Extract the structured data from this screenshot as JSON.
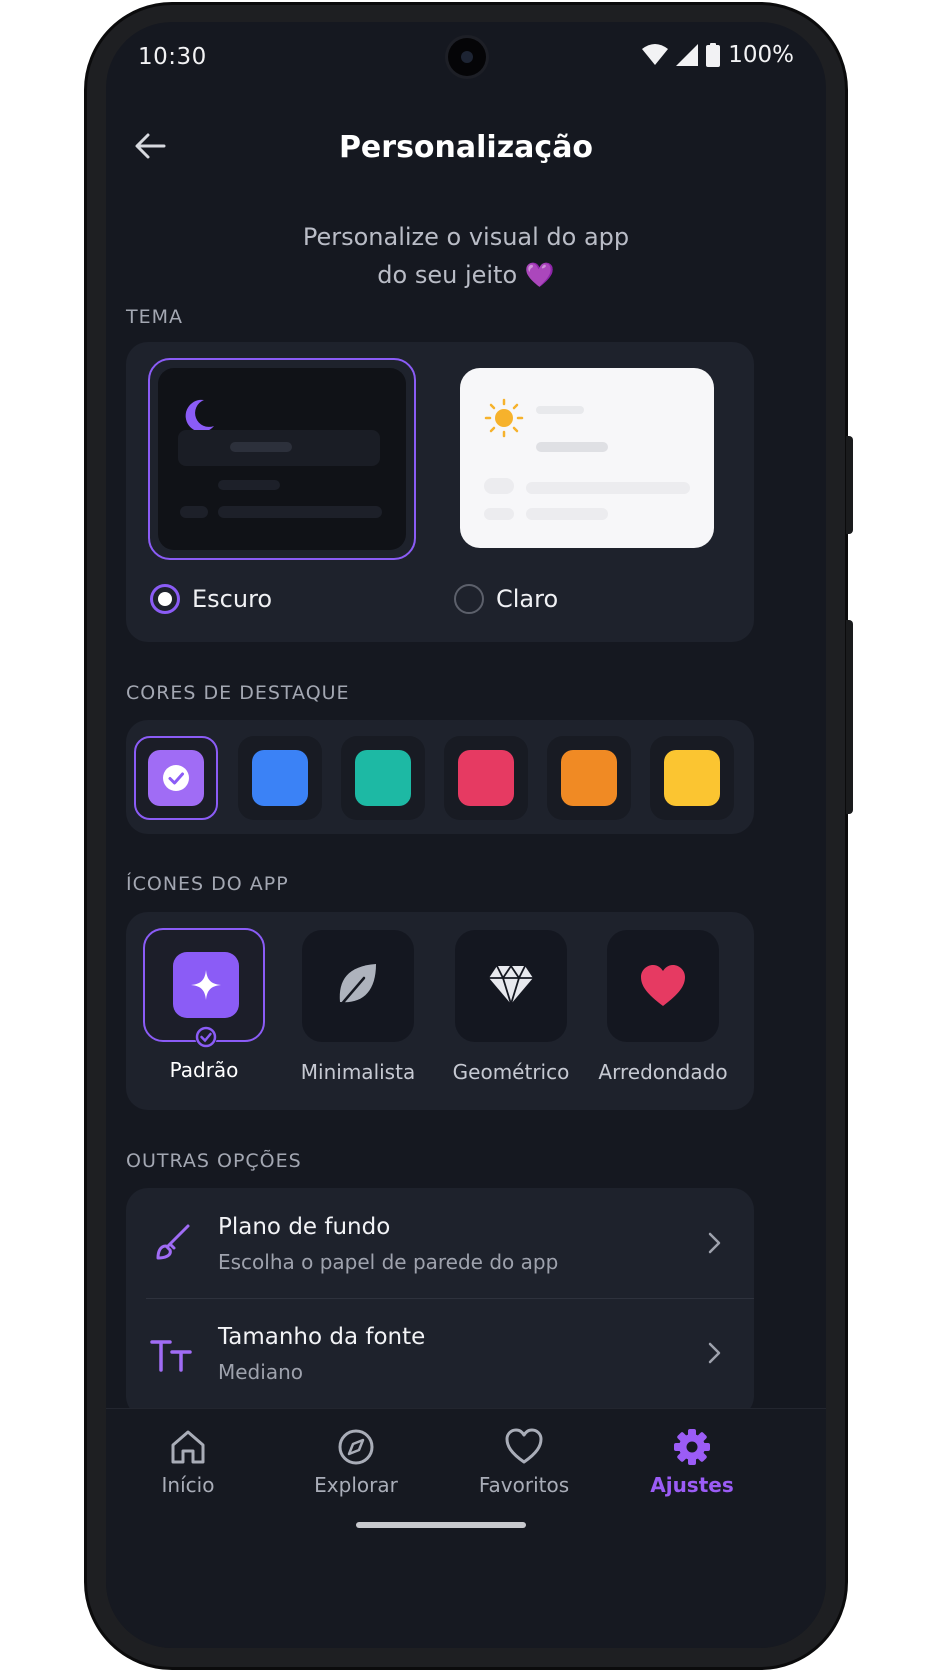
{
  "status": {
    "time": "10:30",
    "battery": "100%"
  },
  "header": {
    "title": "Personalização",
    "subtitle_line1": "Personalize o visual do app",
    "subtitle_line2": "do seu jeito",
    "subtitle_emoji": "💜"
  },
  "theme": {
    "label": "TEMA",
    "options": [
      {
        "label": "Escuro",
        "selected": true
      },
      {
        "label": "Claro",
        "selected": false
      }
    ]
  },
  "accent": {
    "label": "CORES DE DESTAQUE",
    "colors": [
      "#a06cf5",
      "#3b82f6",
      "#1db9a4",
      "#e63a62",
      "#f08a24",
      "#fbc531"
    ],
    "selected_index": 0
  },
  "app_icons": {
    "label": "ÍCONES DO APP",
    "options": [
      {
        "label": "Padrão",
        "icon": "sparkle-icon",
        "selected": true
      },
      {
        "label": "Minimalista",
        "icon": "leaf-icon",
        "selected": false
      },
      {
        "label": "Geométrico",
        "icon": "diamond-icon",
        "selected": false
      },
      {
        "label": "Arredondado",
        "icon": "heart-icon",
        "selected": false
      }
    ]
  },
  "other": {
    "label": "OUTRAS OPÇÕES",
    "items": [
      {
        "title": "Plano de fundo",
        "subtitle": "Escolha o papel de parede do app",
        "icon": "brush-icon"
      },
      {
        "title": "Tamanho da fonte",
        "subtitle": "Mediano",
        "icon": "text-size-icon"
      }
    ]
  },
  "nav": {
    "items": [
      {
        "label": "Início",
        "icon": "home-icon",
        "active": false
      },
      {
        "label": "Explorar",
        "icon": "compass-icon",
        "active": false
      },
      {
        "label": "Favoritos",
        "icon": "heart-outline-icon",
        "active": false
      },
      {
        "label": "Ajustes",
        "icon": "gear-icon",
        "active": true
      }
    ]
  },
  "colors": {
    "accent": "#8b5cf6",
    "background": "#151820",
    "card": "#1e222c"
  }
}
